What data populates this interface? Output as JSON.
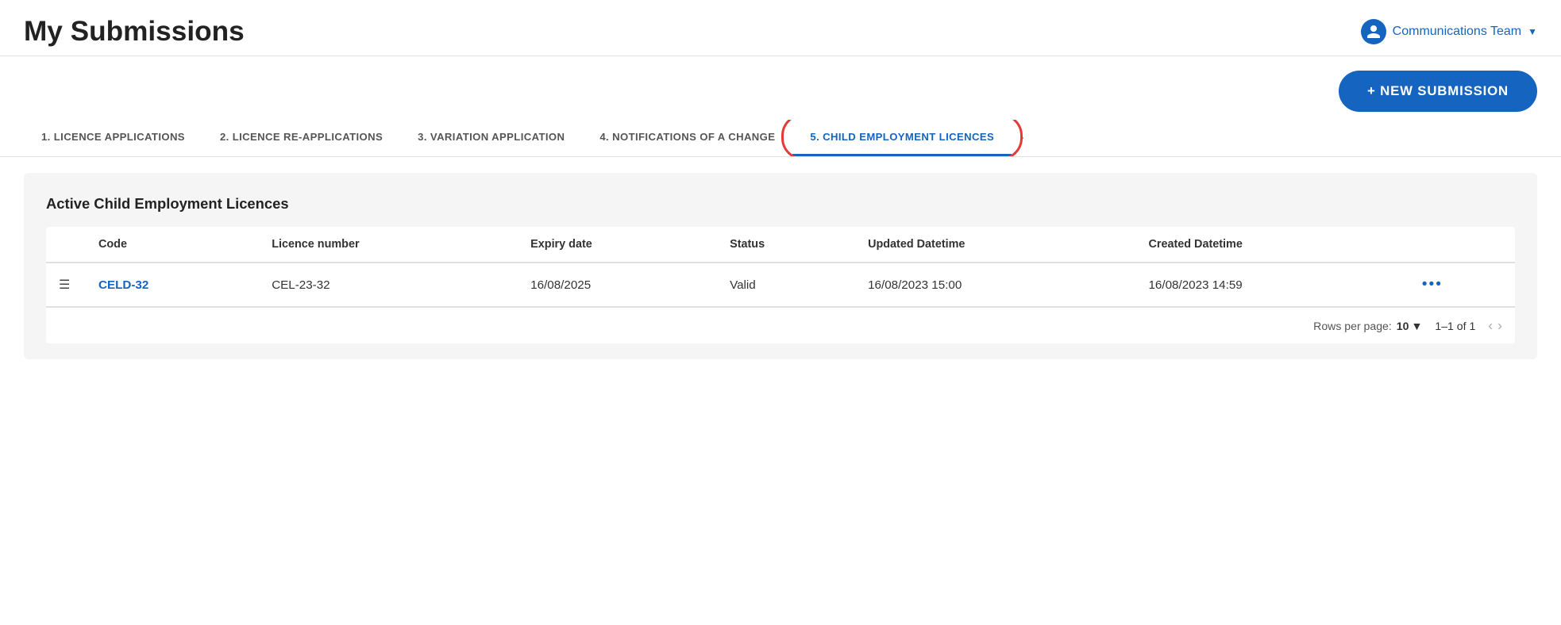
{
  "header": {
    "page_title": "My Submissions",
    "user_name": "Communications Team",
    "user_icon": "person"
  },
  "toolbar": {
    "new_submission_label": "+ NEW SUBMISSION"
  },
  "tabs": [
    {
      "id": "tab1",
      "label": "1. LICENCE APPLICATIONS",
      "active": false
    },
    {
      "id": "tab2",
      "label": "2. LICENCE RE-APPLICATIONS",
      "active": false
    },
    {
      "id": "tab3",
      "label": "3. VARIATION APPLICATION",
      "active": false
    },
    {
      "id": "tab4",
      "label": "4. NOTIFICATIONS OF A CHANGE",
      "active": false
    },
    {
      "id": "tab5",
      "label": "5. CHILD EMPLOYMENT LICENCES",
      "active": true
    }
  ],
  "tab_more_icon": "›",
  "content": {
    "section_title": "Active Child Employment Licences",
    "table": {
      "columns": [
        "",
        "Code",
        "Licence number",
        "Expiry date",
        "Status",
        "Updated Datetime",
        "Created Datetime",
        ""
      ],
      "rows": [
        {
          "icon": "≡",
          "code": "CELD-32",
          "licence_number": "CEL-23-32",
          "expiry_date": "16/08/2025",
          "status": "Valid",
          "updated_datetime": "16/08/2023 15:00",
          "created_datetime": "16/08/2023 14:59",
          "actions": "•••"
        }
      ]
    },
    "pagination": {
      "rows_per_page_label": "Rows per page:",
      "rows_per_page_value": "10",
      "page_info": "1–1 of 1"
    }
  }
}
